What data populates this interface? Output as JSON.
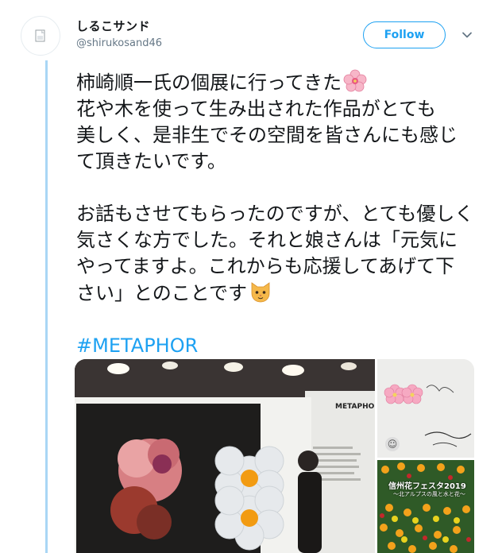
{
  "user": {
    "display_name": "しるこサンド",
    "handle": "@shirukosand46",
    "avatar_icon": "broken-image-icon"
  },
  "header": {
    "follow_label": "Follow",
    "menu_icon": "chevron-down-icon"
  },
  "tweet": {
    "lines": [
      "柿崎順一氏の個展に行ってきた",
      "花や木を使って生み出された作品がとても",
      "美しく、是非生でその空間を皆さんにも感じ",
      "て頂きたいです。",
      "お話もさせてもらったのですが、とても優しく",
      "気さくな方でした。それと娘さんは「元気に",
      "やってますよ。これからも応援してあげて下",
      "さい」とのことです"
    ],
    "emoji_1": "cherry-blossom-icon",
    "emoji_2": "cat-face-icon",
    "hashtag": "#METAPHOR"
  },
  "media": {
    "main_photo": "exhibition-photo",
    "panel_label": "METAPHOR",
    "side_top_photo": "signed-card-photo",
    "side_bottom_photo": "flower-festival-photo",
    "side_bottom_caption": "信州花フェスタ2019",
    "side_bottom_subcaption": "～北アルプスの風と水と花～"
  },
  "colors": {
    "accent": "#1da1f2",
    "thread_line": "#a9d6f5",
    "secondary_text": "#657786"
  }
}
